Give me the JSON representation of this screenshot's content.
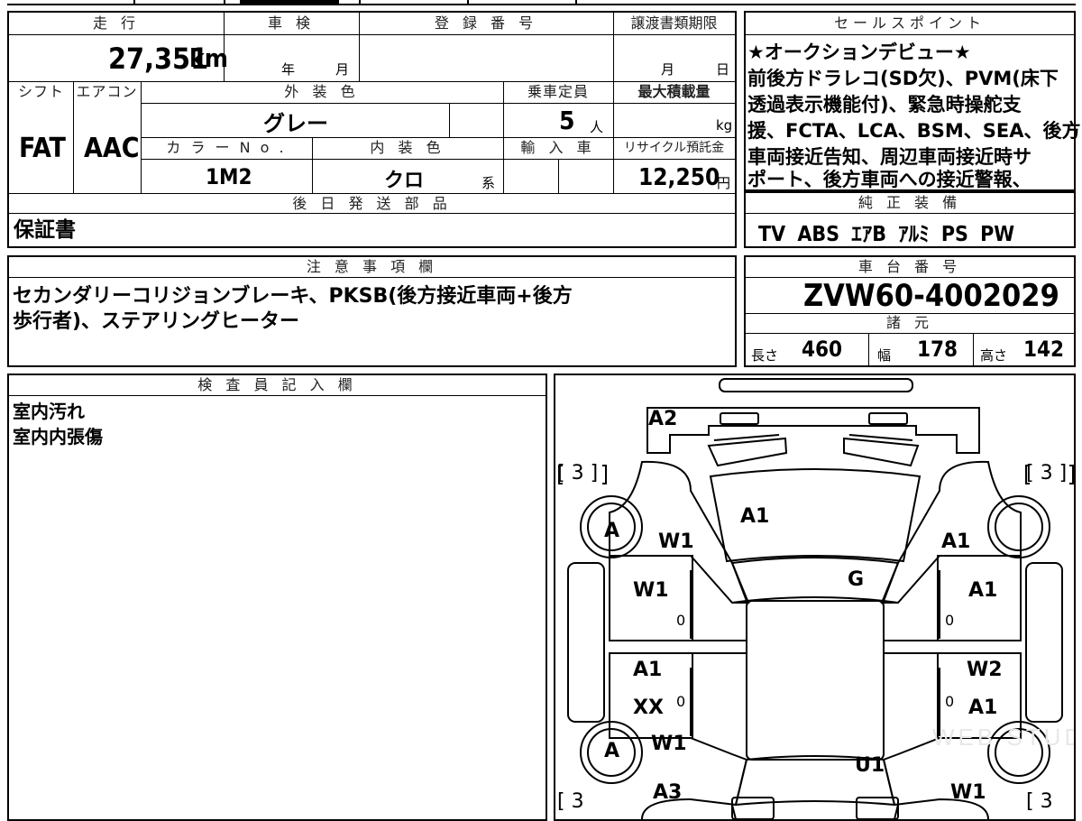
{
  "main": {
    "headers": {
      "mileage": "走 行",
      "inspection": "車 検",
      "registration": "登 録 番 号",
      "transfer_deadline": "譲渡書類期限",
      "shift": "シフト",
      "aircon": "エアコン",
      "exterior_color": "外 装 色",
      "capacity": "乗車定員",
      "max_load": "最大積載量",
      "color_no": "カ ラ ー N o .",
      "interior_color": "内 装 色",
      "import": "輸 入 車",
      "recycle": "リサイクル預託金",
      "later_parts": "後 日 発 送 部 品"
    },
    "mileage_value": "27,351",
    "mileage_unit": "km",
    "inspection_year": "年",
    "inspection_month": "月",
    "deadline_month": "月",
    "deadline_day": "日",
    "shift_value": "FAT",
    "aircon_value": "AAC",
    "exterior_color_value": "グレー",
    "capacity_value": "5",
    "capacity_unit": "人",
    "max_load_unit": "kg",
    "color_no_value": "1M2",
    "interior_color_value": "クロ",
    "interior_suffix": "系",
    "recycle_value": "12,250",
    "recycle_unit": "円",
    "later_parts_value": "保証書"
  },
  "sales": {
    "header": "セールスポイント",
    "lines": [
      "★オークションデビュー★",
      "前後方ドラレコ(SD欠)、PVM(床下",
      "透過表示機能付)、緊急時操舵支",
      "援、FCTA、LCA、BSM、SEA、後方",
      "車両接近告知、周辺車両接近時サ",
      "ポート、後方車両への接近警報、"
    ]
  },
  "equipment": {
    "header": "純 正 装 備",
    "value": "TV ABS ｴｱB ｱﾙﾐ PS PW"
  },
  "notes": {
    "header": "注 意 事 項 欄",
    "lines": [
      "セカンダリーコリジョンブレーキ、PKSB(後方接近車両+後方",
      "歩行者)、ステアリングヒーター"
    ]
  },
  "chassis": {
    "header": "車 台 番 号",
    "value": "ZVW60-4002029"
  },
  "specs": {
    "header": "諸 元",
    "length_label": "長さ",
    "length": "460",
    "width_label": "幅",
    "width": "178",
    "height_label": "高さ",
    "height": "142"
  },
  "inspector": {
    "header": "検 査 員 記 入 欄",
    "lines": [
      "室内汚れ",
      "室内内張傷"
    ]
  },
  "diagram": {
    "marks": {
      "a2": "A2",
      "tire_fl": "[ 3 ]",
      "tire_fr": "[ 3 ]",
      "tire_rl": "[ 3",
      "tire_rr": "[ 3",
      "wheel_fl": "A",
      "wheel_rl": "A",
      "hood": "A1",
      "fender_l": "W1",
      "fender_r": "A1",
      "glass": "G",
      "door_fl": "W1",
      "door_fr": "A1",
      "door_rl_a": "A1",
      "door_rl_b": "XX",
      "door_rr_a": "W2",
      "door_rr_b": "A1",
      "qtr_l": "W1",
      "qtr_r": "W1",
      "roof_back": "U1",
      "rear_l": "A3",
      "zero": "0"
    }
  }
}
